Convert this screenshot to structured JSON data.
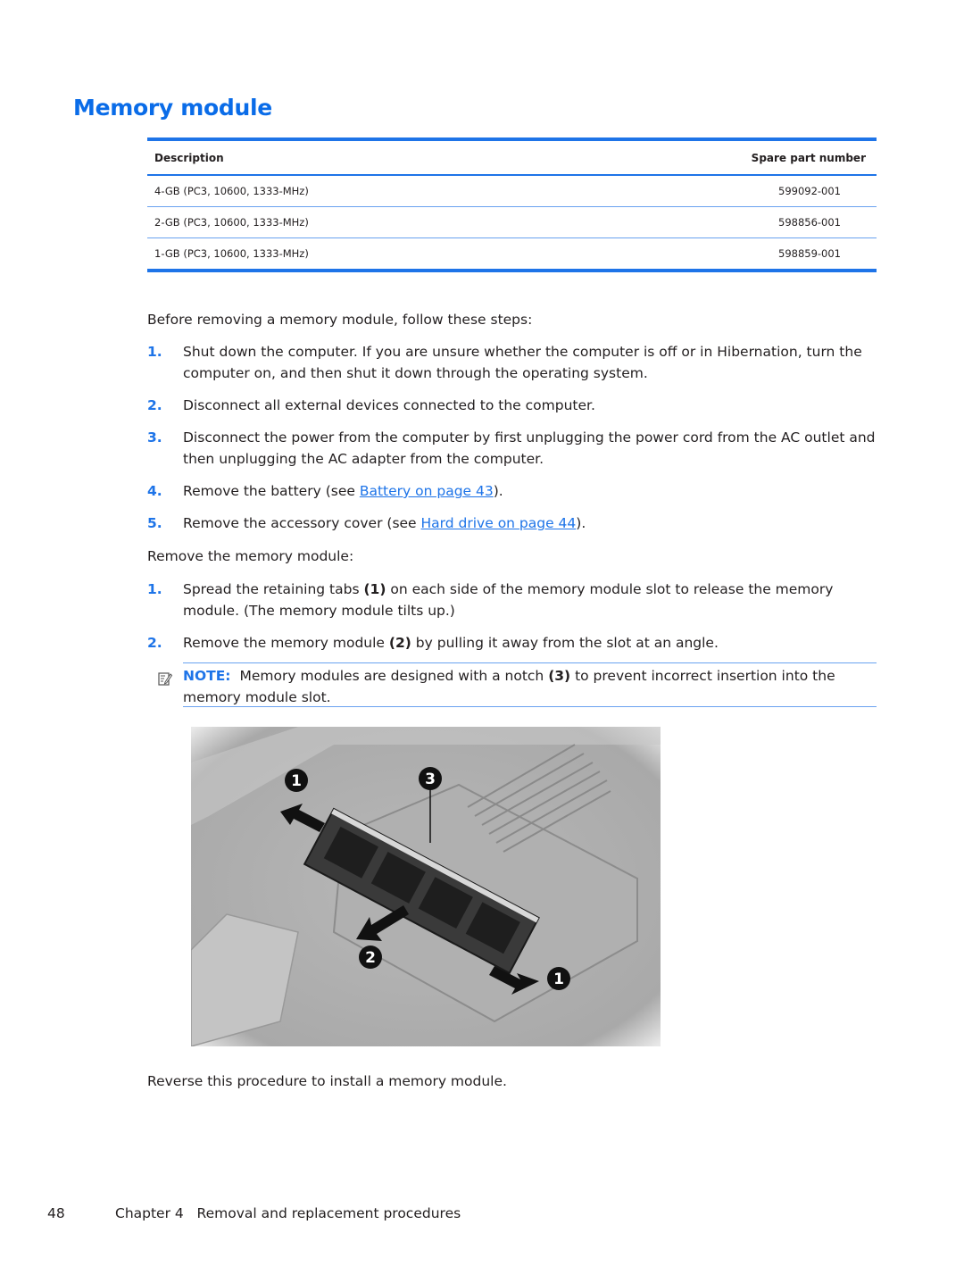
{
  "page": {
    "title": "Memory module",
    "table": {
      "headers": [
        "Description",
        "Spare part number"
      ],
      "rows": [
        [
          "4-GB (PC3, 10600, 1333-MHz)",
          "599092-001"
        ],
        [
          "2-GB (PC3, 10600, 1333-MHz)",
          "598856-001"
        ],
        [
          "1-GB (PC3, 10600, 1333-MHz)",
          "598859-001"
        ]
      ]
    },
    "intro": "Before removing a memory module, follow these steps:",
    "prep_steps": [
      {
        "num": "1.",
        "text": "Shut down the computer. If you are unsure whether the computer is off or in Hibernation, turn the computer on, and then shut it down through the operating system."
      },
      {
        "num": "2.",
        "text": "Disconnect all external devices connected to the computer."
      },
      {
        "num": "3.",
        "text": "Disconnect the power from the computer by first unplugging the power cord from the AC outlet and then unplugging the AC adapter from the computer."
      },
      {
        "num": "4.",
        "pre": "Remove the battery (see ",
        "link": "Battery on page 43",
        "post": ")."
      },
      {
        "num": "5.",
        "pre": "Remove the accessory cover (see ",
        "link": "Hard drive on page 44",
        "post": ")."
      }
    ],
    "remove_intro": "Remove the memory module:",
    "remove_steps": [
      {
        "num": "1.",
        "pre": "Spread the retaining tabs ",
        "ref": "(1)",
        "post": " on each side of the memory module slot to release the memory module. (The memory module tilts up.)"
      },
      {
        "num": "2.",
        "pre": "Remove the memory module ",
        "ref": "(2)",
        "post": " by pulling it away from the slot at an angle."
      }
    ],
    "note": {
      "label": "NOTE:",
      "pre": "Memory modules are designed with a notch ",
      "ref": "(3)",
      "post": " to prevent incorrect insertion into the memory module slot."
    },
    "figure": {
      "callouts": [
        "1",
        "3",
        "2",
        "1"
      ]
    },
    "closing": "Reverse this procedure to install a memory module.",
    "footer": {
      "page_number": "48",
      "chapter": "Chapter 4   Removal and replacement procedures"
    }
  },
  "colors": {
    "accent": "#1e74e8",
    "title": "#0a6ce8",
    "text": "#231f20"
  }
}
